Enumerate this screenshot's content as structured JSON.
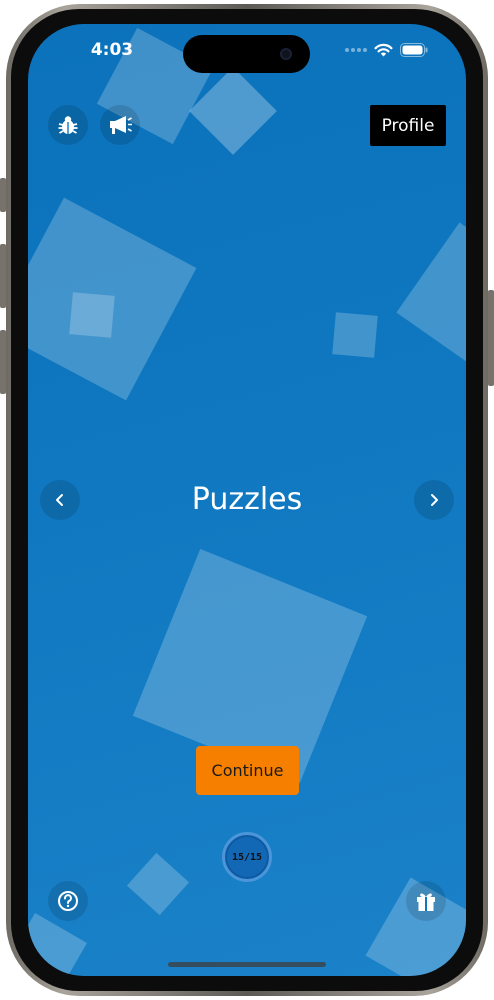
{
  "status_bar": {
    "time": "4:03"
  },
  "toolbar": {
    "debug_icon": "bug-icon",
    "announce_icon": "megaphone-icon",
    "profile_label": "Profile"
  },
  "main": {
    "title": "Puzzles",
    "prev_icon": "chevron-left-icon",
    "next_icon": "chevron-right-icon",
    "continue_label": "Continue",
    "progress_label": "15/15"
  },
  "bottom_bar": {
    "help_icon": "question-icon",
    "gift_icon": "gift-icon"
  },
  "colors": {
    "background": "#0f78c0",
    "continue_button": "#f77f00",
    "profile_button": "#000000"
  }
}
